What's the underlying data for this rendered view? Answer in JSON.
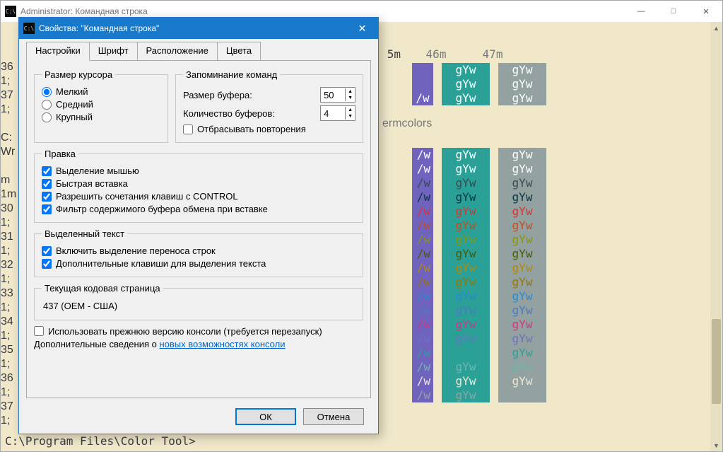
{
  "window": {
    "title": "Administrator: Командная строка",
    "prompt": "C:\\Program Files\\Color Tool>",
    "termcolors_hint": "ermcolors"
  },
  "left_fragments": [
    "36",
    "1;",
    "37",
    "1;",
    "",
    "C:",
    "Wr",
    "",
    "m",
    "1m",
    "30",
    "1;",
    "31",
    "1;",
    "32",
    "1;",
    "33",
    "1;",
    "34",
    "1;",
    "35",
    "1;",
    "36",
    "1;",
    "37",
    "1;"
  ],
  "grid": {
    "header_frag": "5m",
    "headers": [
      "46m",
      "47m"
    ],
    "sample": "gYw",
    "partial_sample": "/w",
    "columns": [
      {
        "bg": "#6f63bd"
      },
      {
        "bg": "#2aa097"
      },
      {
        "bg": "#93a1a1"
      }
    ],
    "row_colors": [
      "#ffffff",
      "#ffffff",
      "#3a4a52",
      "#073642",
      "#dc322f",
      "#cb4b16",
      "#859900",
      "#4a5a00",
      "#b58900",
      "#9a7500",
      "#268bd2",
      "#4a7bc0",
      "#d33682",
      "#6c71c4",
      "#2aa198",
      "#6fb5ab",
      "#eee8d5",
      "#93a1a1"
    ]
  },
  "dialog": {
    "title": "Свойства: \"Командная строка\"",
    "tabs": [
      "Настройки",
      "Шрифт",
      "Расположение",
      "Цвета"
    ],
    "cursor": {
      "legend": "Размер курсора",
      "options": [
        "Мелкий",
        "Средний",
        "Крупный"
      ],
      "selected": 0
    },
    "history": {
      "legend": "Запоминание команд",
      "buffer_size_label": "Размер буфера:",
      "buffer_size": "50",
      "num_buffers_label": "Количество буферов:",
      "num_buffers": "4",
      "discard_dupes": "Отбрасывать повторения",
      "discard_checked": false
    },
    "edit": {
      "legend": "Правка",
      "items": [
        {
          "label": "Выделение мышью",
          "checked": true
        },
        {
          "label": "Быстрая вставка",
          "checked": true
        },
        {
          "label": "Разрешить сочетания клавиш с CONTROL",
          "checked": true
        },
        {
          "label": "Фильтр содержимого буфера обмена при вставке",
          "checked": true
        }
      ]
    },
    "selection": {
      "legend": "Выделенный текст",
      "items": [
        {
          "label": "Включить выделение переноса строк",
          "checked": true
        },
        {
          "label": "Дополнительные клавиши для выделения текста",
          "checked": true
        }
      ]
    },
    "codepage": {
      "legend": "Текущая кодовая страница",
      "value": "437  (OEM - США)"
    },
    "legacy": {
      "checkbox": "Использовать прежнюю версию консоли (требуется перезапуск)",
      "checked": false,
      "more_prefix": "Дополнительные сведения о ",
      "link": "новых возможностях консоли"
    },
    "buttons": {
      "ok": "ОК",
      "cancel": "Отмена"
    }
  }
}
